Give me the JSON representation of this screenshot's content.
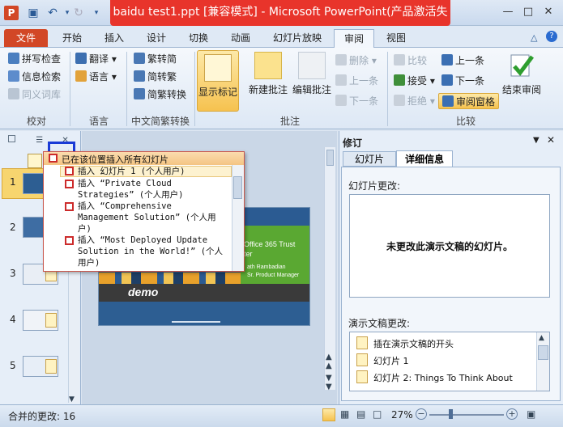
{
  "window": {
    "app_icon": "P",
    "title": "baidu test1.ppt [兼容模式] - Microsoft PowerPoint(产品激活失败)"
  },
  "tabs": [
    "文件",
    "开始",
    "插入",
    "设计",
    "切换",
    "动画",
    "幻灯片放映",
    "审阅",
    "视图"
  ],
  "ribbon": {
    "proofing": {
      "spell": "拼写检查",
      "research": "信息检索",
      "thesaurus": "同义词库",
      "label": "校对"
    },
    "language": {
      "translate": "翻译",
      "language": "语言",
      "label": "语言"
    },
    "chinese": {
      "t2s": "繁转简",
      "s2t": "简转繁",
      "convert": "简繁转换",
      "label": "中文简繁转换"
    },
    "comments": {
      "show": "显示标记",
      "new": "新建批注",
      "edit": "编辑批注",
      "delete": "删除",
      "prev": "上一条",
      "next": "下一条",
      "label": "批注"
    },
    "compare": {
      "compare": "比较",
      "accept": "接受",
      "reject": "拒绝",
      "prev": "上一条",
      "next": "下一条",
      "pane": "审阅窗格",
      "end": "结束审阅",
      "label": "比较"
    }
  },
  "slides": [
    "1",
    "2",
    "3",
    "4",
    "5"
  ],
  "popup": {
    "header": "已在该位置插入所有幻灯片",
    "items": [
      {
        "line1": "插入 幻灯片 1 (个人用户)",
        "line2": ""
      },
      {
        "line1": "插入 “Private Cloud",
        "line2": "Strategies” (个人用户)"
      },
      {
        "line1": "插入 “Comprehensive",
        "line2": "Management Solution” (个人用",
        "line3": "户)"
      },
      {
        "line1": "插入 “Most Deployed Update",
        "line2": "Solution in the World!” (个人",
        "line3": "用户)"
      }
    ]
  },
  "slide_canvas": {
    "product": "Office 365 Trust",
    "product2": "ter",
    "presenter": "ath Rambadian",
    "role": "Sr. Product Manager",
    "demo": "demo"
  },
  "review_pane": {
    "title": "修订",
    "tab_slides": "幻灯片",
    "tab_details": "详细信息",
    "slide_changes_label": "幻灯片更改:",
    "no_changes": "未更改此演示文稿的幻灯片。",
    "pres_changes_label": "演示文稿更改:",
    "changes": [
      "插在演示文稿的开头",
      "幻灯片 1",
      "幻灯片 2: Things To Think About"
    ]
  },
  "status": {
    "merged": "合并的更改: 16",
    "zoom": "27%"
  },
  "colors": {
    "file_tab": "#d24726",
    "title_highlight": "#e8342b",
    "accent_blue": "#2d5e92",
    "slide_green": "#5aa832"
  }
}
